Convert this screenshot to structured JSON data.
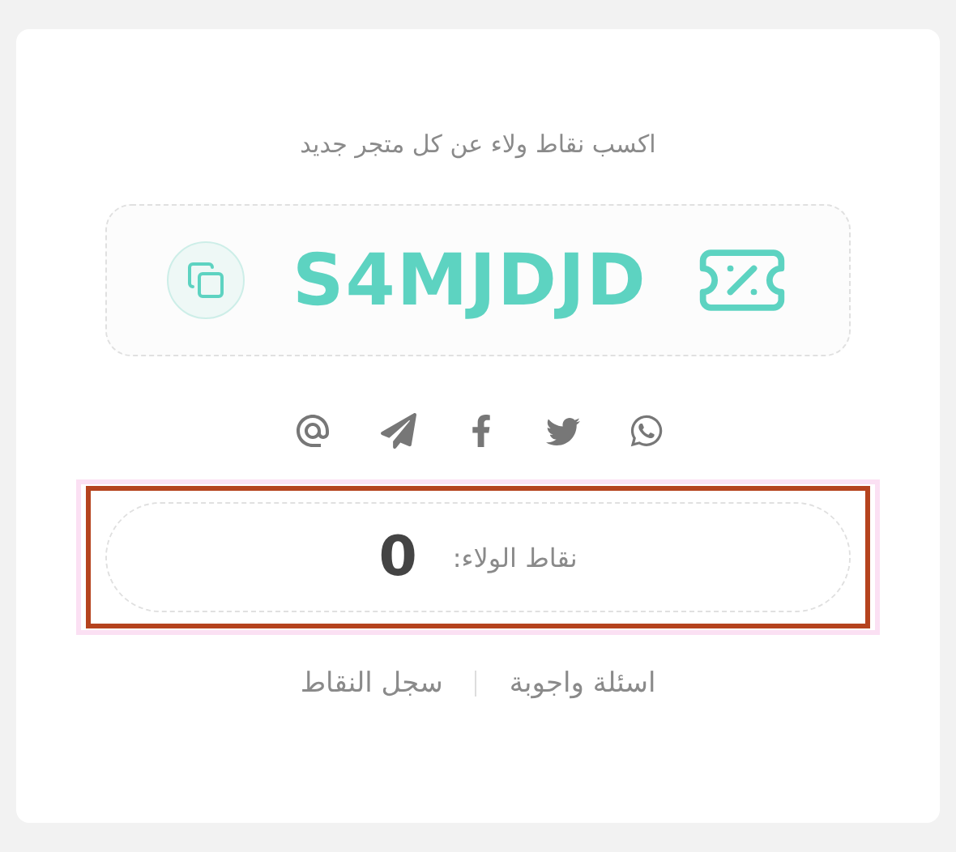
{
  "subtitle": "اكسب نقاط ولاء عن كل متجر جديد",
  "coupon": {
    "code": "S4MJDJD"
  },
  "share": [
    {
      "kind": "whatsapp"
    },
    {
      "kind": "twitter"
    },
    {
      "kind": "facebook"
    },
    {
      "kind": "telegram"
    },
    {
      "kind": "email"
    }
  ],
  "points": {
    "label": "نقاط الولاء:",
    "value": "0"
  },
  "links": [
    "اسئلة واجوبة",
    "سجل النقاط"
  ]
}
